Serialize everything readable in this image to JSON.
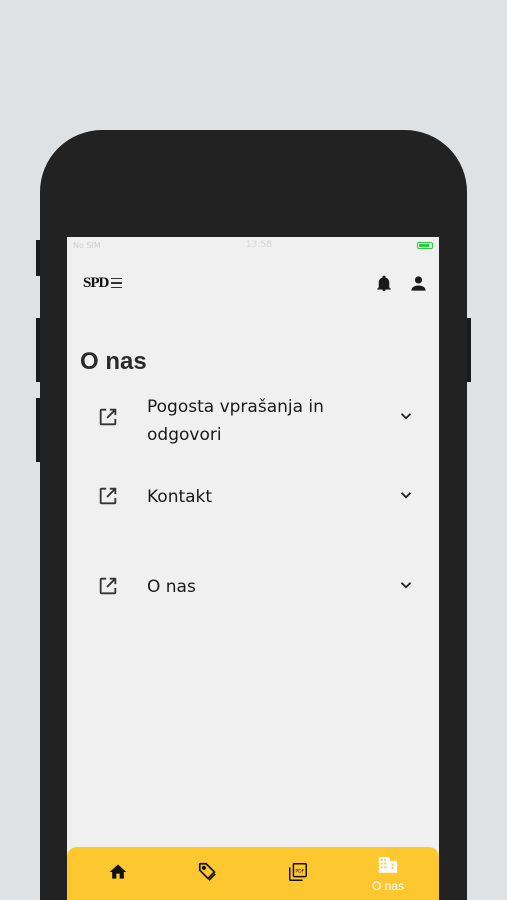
{
  "status_bar": {
    "carrier": "No SIM",
    "time": "13:58"
  },
  "header": {
    "logo_text": "SPD"
  },
  "page": {
    "title": "O nas"
  },
  "items": [
    {
      "label": "Pogosta vprašanja in odgovori"
    },
    {
      "label": "Kontakt"
    },
    {
      "label": "O nas"
    }
  ],
  "bottom_nav": {
    "active_label": "O nas",
    "items": [
      "home-icon",
      "tag-icon",
      "pdf-icon",
      "building-icon"
    ]
  },
  "colors": {
    "accent": "#fdc730",
    "background": "#f0f0f0",
    "frame": "#222222"
  }
}
